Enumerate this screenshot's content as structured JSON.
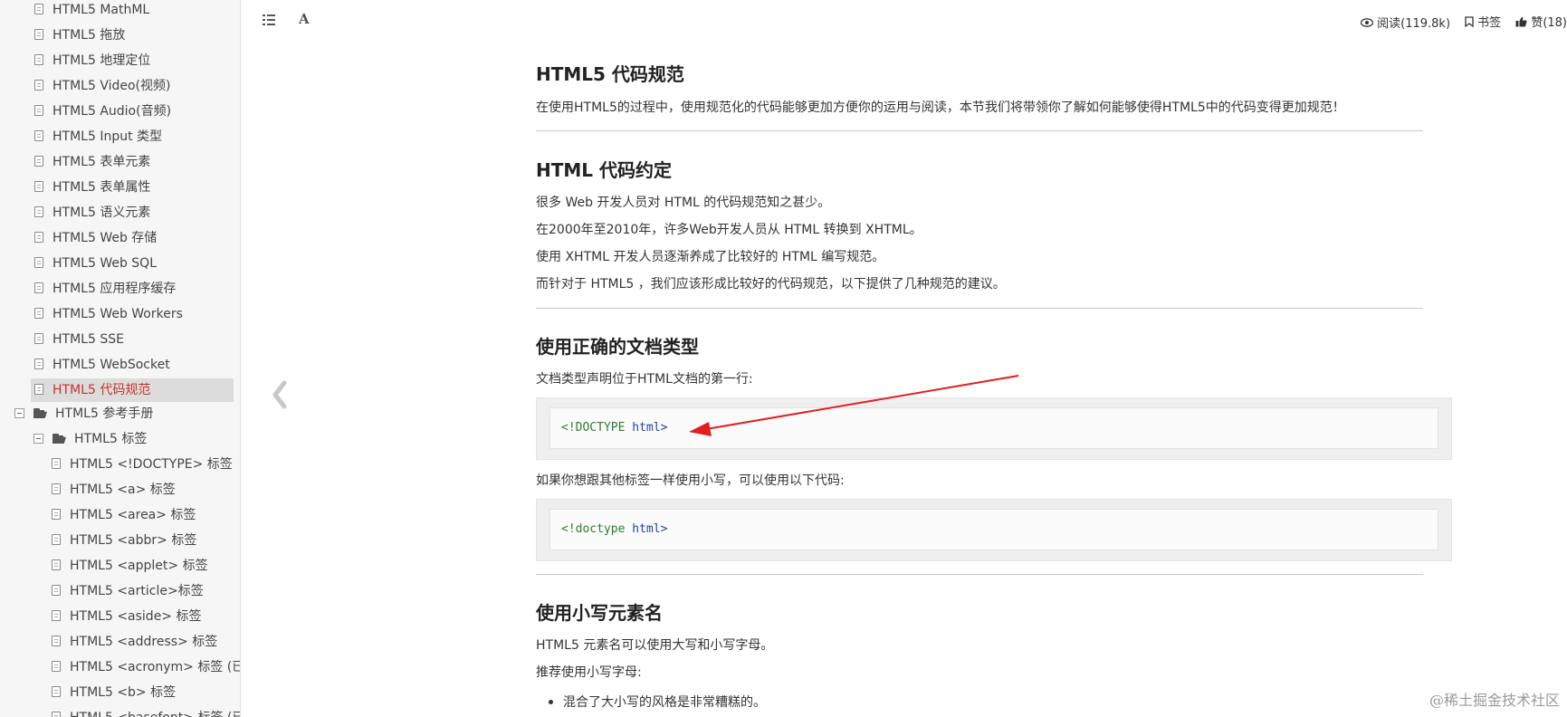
{
  "sidebar": {
    "items_top": [
      {
        "label": "HTML5 MathML"
      },
      {
        "label": "HTML5 拖放"
      },
      {
        "label": "HTML5 地理定位"
      },
      {
        "label": "HTML5 Video(视频)"
      },
      {
        "label": "HTML5 Audio(音频)"
      },
      {
        "label": "HTML5 Input 类型"
      },
      {
        "label": "HTML5 表单元素"
      },
      {
        "label": "HTML5 表单属性"
      },
      {
        "label": "HTML5 语义元素"
      },
      {
        "label": "HTML5 Web 存储"
      },
      {
        "label": "HTML5 Web SQL"
      },
      {
        "label": "HTML5 应用程序缓存"
      },
      {
        "label": "HTML5 Web Workers"
      },
      {
        "label": "HTML5 SSE"
      },
      {
        "label": "HTML5 WebSocket"
      },
      {
        "label": "HTML5 代码规范",
        "active": true
      }
    ],
    "folder_reference": "HTML5 参考手册",
    "folder_tags": "HTML5 标签",
    "items_tags": [
      {
        "label": "HTML5 <!DOCTYPE> 标签"
      },
      {
        "label": "HTML5 <a> 标签"
      },
      {
        "label": "HTML5 <area> 标签"
      },
      {
        "label": "HTML5 <abbr> 标签"
      },
      {
        "label": "HTML5 <applet> 标签"
      },
      {
        "label": "HTML5 <article>标签"
      },
      {
        "label": "HTML5 <aside> 标签"
      },
      {
        "label": "HTML5 <address> 标签"
      },
      {
        "label": "HTML5 <acronym> 标签 (已"
      },
      {
        "label": "HTML5 <b> 标签"
      },
      {
        "label": "HTML5 <basefont> 标签 (已"
      }
    ]
  },
  "toolbar": {
    "read_label": "阅读(119.8k)",
    "bookmark_label": "书签",
    "like_label": "赞(18)",
    "font_label": "A"
  },
  "content": {
    "s1_title": "HTML5 代码规范",
    "s1_intro": "在使用HTML5的过程中，使用规范化的代码能够更加方便你的运用与阅读，本节我们将带领你了解如何能够使得HTML5中的代码变得更加规范！",
    "s2_title": "HTML 代码约定",
    "s2_p1": "很多 Web 开发人员对 HTML 的代码规范知之甚少。",
    "s2_p2": "在2000年至2010年，许多Web开发人员从 HTML 转换到 XHTML。",
    "s2_p3": "使用 XHTML 开发人员逐渐养成了比较好的 HTML 编写规范。",
    "s2_p4": "而针对于 HTML5 ，我们应该形成比较好的代码规范，以下提供了几种规范的建议。",
    "s3_title": "使用正确的文档类型",
    "s3_p1": "文档类型声明位于HTML文档的第一行:",
    "code1_part1": "<!DOCTYPE",
    "code1_part2": "html>",
    "s3_p2": "如果你想跟其他标签一样使用小写，可以使用以下代码:",
    "code2_part1": "<!doctype",
    "code2_part2": "html>",
    "s4_title": "使用小写元素名",
    "s4_p1": "HTML5 元素名可以使用大写和小写字母。",
    "s4_p2": "推荐使用小写字母:",
    "s4_bullet1": "混合了大小写的风格是非常糟糕的。"
  },
  "annotation": {
    "arrow_color": "#e02020"
  },
  "watermark": "@稀土掘金技术社区"
}
